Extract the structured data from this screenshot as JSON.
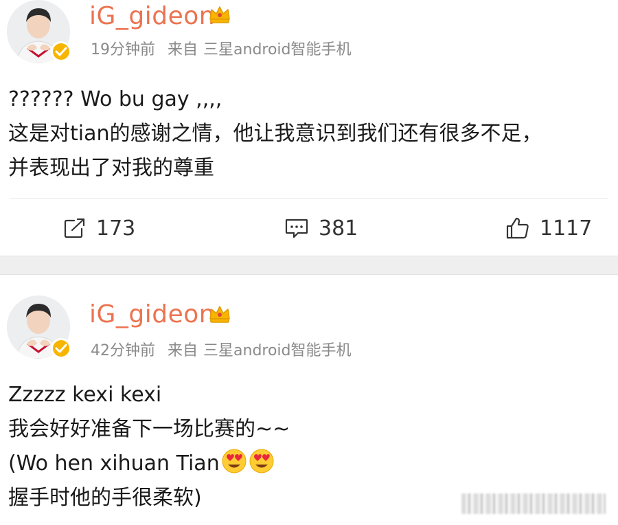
{
  "posts": [
    {
      "username": "iG_gideon",
      "time": "19分钟前",
      "from_label": "来自",
      "device": "三星android智能手机",
      "lines": [
        "?????? Wo bu gay ,,,,",
        "这是对tian的感谢之情，他让我意识到我们还有很多不足，",
        "并表现出了对我的尊重"
      ],
      "actions": {
        "repost_count": "173",
        "comment_count": "381",
        "like_count": "1117"
      }
    },
    {
      "username": "iG_gideon",
      "time": "42分钟前",
      "from_label": "来自",
      "device": "三星android智能手机",
      "lines": [
        "Zzzzz kexi kexi",
        "我会好好准备下一场比赛的~~",
        "(Wo hen xihuan Tian",
        "握手时他的手很柔软)"
      ]
    }
  ],
  "colors": {
    "username": "#eb7350",
    "meta": "#8a8a8a",
    "badge": "#f7b500",
    "band": "#efefef"
  },
  "icons": {
    "crown": "crown-icon",
    "verified": "verified-badge-icon",
    "repost": "repost-icon",
    "comment": "comment-icon",
    "like": "thumbs-up-icon",
    "emoji": "heart-eyes-emoji-icon"
  }
}
